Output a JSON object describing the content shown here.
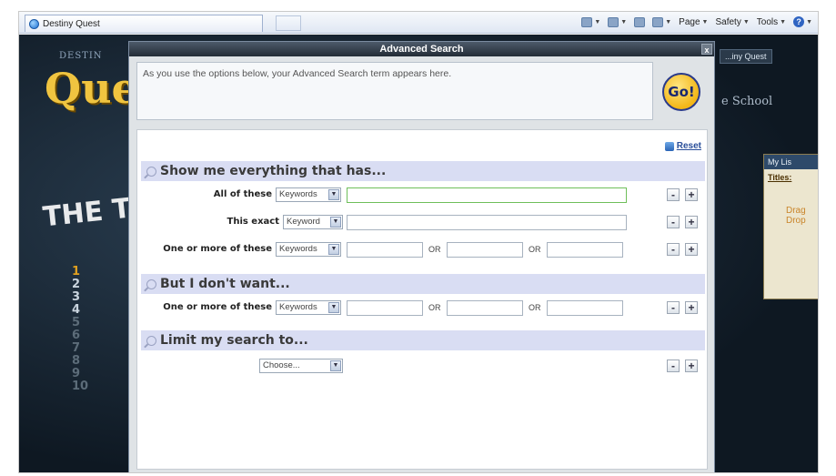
{
  "browser": {
    "tab_title": "Destiny Quest",
    "tools": {
      "page": "Page",
      "safety": "Safety",
      "tools": "Tools",
      "help": "?"
    }
  },
  "background": {
    "brand_small": "DESTIN",
    "brand_large": "Que",
    "top_ten": "THE TOP",
    "numbers": [
      "1",
      "2",
      "3",
      "4",
      "5",
      "6",
      "7",
      "8",
      "9",
      "10"
    ],
    "quest_tab": "...iny Quest",
    "school": "e School",
    "my_list_header": "My Lis",
    "my_list_titles": "Titles:",
    "drag_drop": "Drag Drop"
  },
  "modal": {
    "title": "Advanced Search",
    "close": "x",
    "term_hint": "As you use the options below, your Advanced Search term appears here.",
    "go_label": "Go!",
    "reset_label": "Reset",
    "sections": {
      "has": "Show me everything that has...",
      "dont_want": "But I don't want...",
      "limit": "Limit my search to..."
    },
    "rows": {
      "all_of_these": {
        "label": "All of these",
        "select": "Keywords"
      },
      "this_exact": {
        "label": "This exact",
        "select": "Keyword"
      },
      "one_or_more": {
        "label": "One or more of these",
        "select": "Keywords",
        "or": "OR"
      },
      "exclude_one_or_more": {
        "label": "One or more of these",
        "select": "Keywords",
        "or": "OR"
      },
      "limit_choose": {
        "select": "Choose..."
      }
    },
    "minus": "-",
    "plus": "+"
  },
  "colors": {
    "section_bg": "#d9ddf3",
    "title_bar": "#2e3743",
    "go_yellow": "#f3b617",
    "focus_green": "#6fbf5a"
  }
}
